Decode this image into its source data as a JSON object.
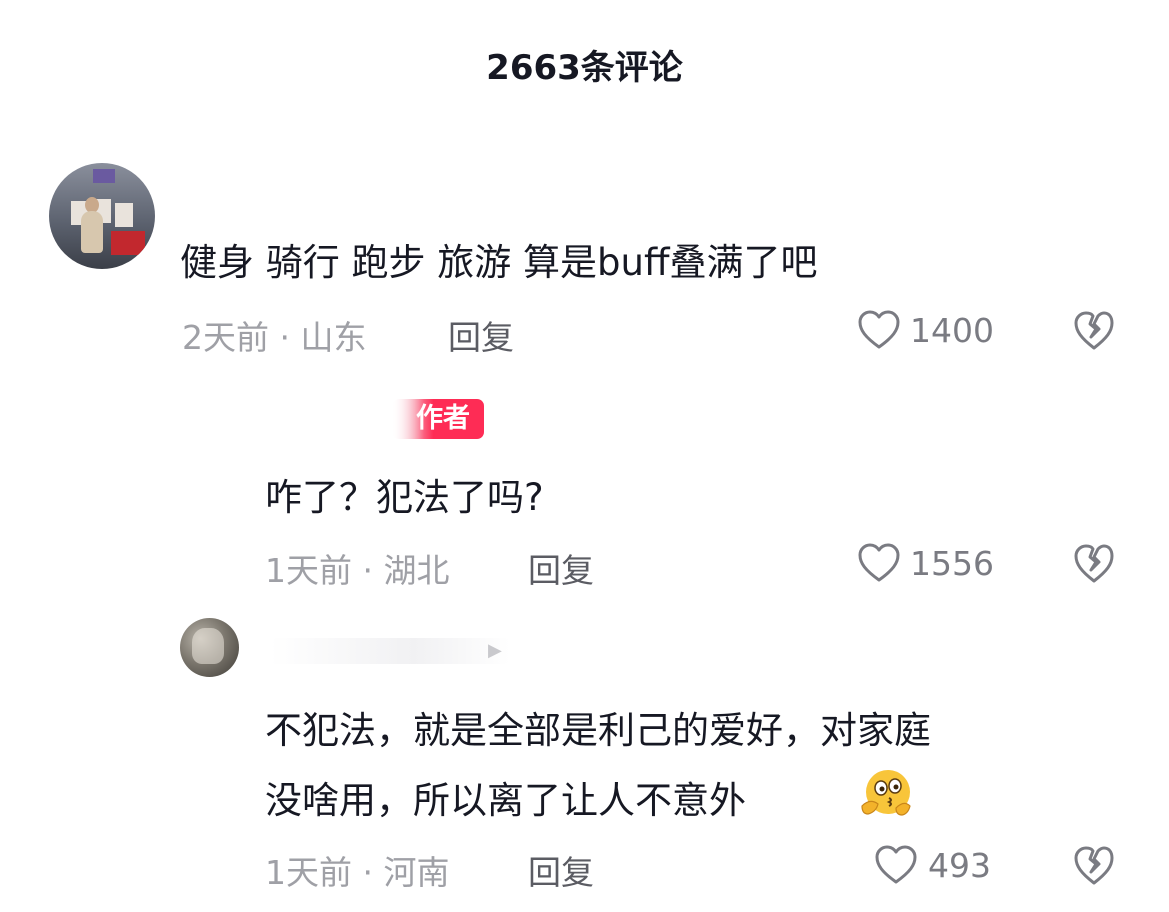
{
  "header": {
    "comment_count_title": "2663条评论"
  },
  "comments": [
    {
      "text": "健身 骑行 跑步 旅游  算是buff叠满了吧",
      "time": "2天前",
      "location": "山东",
      "reply_label": "回复",
      "likes": "1400"
    },
    {
      "badge": "作者",
      "text": "咋了？犯法了吗?",
      "time": "1天前",
      "location": "湖北",
      "reply_label": "回复",
      "likes": "1556"
    },
    {
      "text_line1": "不犯法，就是全部是利己的爱好，对家庭",
      "text_line2": "没啥用，所以离了让人不意外",
      "emoji": "thinking-face-emoji",
      "time": "1天前",
      "location": "河南",
      "reply_label": "回复",
      "likes": "493"
    }
  ],
  "icons": {
    "like": "heart-outline-icon",
    "dislike": "broken-heart-icon",
    "badge_color": "#fe2c55"
  }
}
